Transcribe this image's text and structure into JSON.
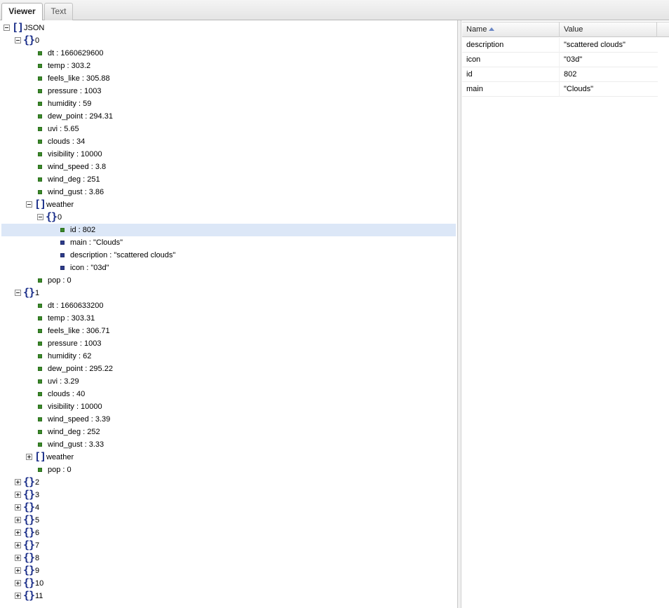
{
  "tabs": [
    {
      "label": "Viewer",
      "active": true
    },
    {
      "label": "Text",
      "active": false
    }
  ],
  "tree": [
    {
      "level": 0,
      "kind": "array",
      "label": "JSON",
      "toggle": "minus"
    },
    {
      "level": 1,
      "kind": "object",
      "label": "0",
      "toggle": "minus"
    },
    {
      "level": 2,
      "kind": "leaf",
      "label": "dt : 1660629600"
    },
    {
      "level": 2,
      "kind": "leaf",
      "label": "temp : 303.2"
    },
    {
      "level": 2,
      "kind": "leaf",
      "label": "feels_like : 305.88"
    },
    {
      "level": 2,
      "kind": "leaf",
      "label": "pressure : 1003"
    },
    {
      "level": 2,
      "kind": "leaf",
      "label": "humidity : 59"
    },
    {
      "level": 2,
      "kind": "leaf",
      "label": "dew_point : 294.31"
    },
    {
      "level": 2,
      "kind": "leaf",
      "label": "uvi : 5.65"
    },
    {
      "level": 2,
      "kind": "leaf",
      "label": "clouds : 34"
    },
    {
      "level": 2,
      "kind": "leaf",
      "label": "visibility : 10000"
    },
    {
      "level": 2,
      "kind": "leaf",
      "label": "wind_speed : 3.8"
    },
    {
      "level": 2,
      "kind": "leaf",
      "label": "wind_deg : 251"
    },
    {
      "level": 2,
      "kind": "leaf",
      "label": "wind_gust : 3.86"
    },
    {
      "level": 2,
      "kind": "array",
      "label": "weather",
      "toggle": "minus"
    },
    {
      "level": 3,
      "kind": "object",
      "label": "0",
      "toggle": "minus"
    },
    {
      "level": 4,
      "kind": "leaf",
      "label": "id : 802",
      "selected": true
    },
    {
      "level": 4,
      "kind": "leaf",
      "label": "main : \"Clouds\"",
      "blue": true
    },
    {
      "level": 4,
      "kind": "leaf",
      "label": "description : \"scattered clouds\"",
      "blue": true
    },
    {
      "level": 4,
      "kind": "leaf",
      "label": "icon : \"03d\"",
      "blue": true
    },
    {
      "level": 2,
      "kind": "leaf",
      "label": "pop : 0"
    },
    {
      "level": 1,
      "kind": "object",
      "label": "1",
      "toggle": "minus"
    },
    {
      "level": 2,
      "kind": "leaf",
      "label": "dt : 1660633200"
    },
    {
      "level": 2,
      "kind": "leaf",
      "label": "temp : 303.31"
    },
    {
      "level": 2,
      "kind": "leaf",
      "label": "feels_like : 306.71"
    },
    {
      "level": 2,
      "kind": "leaf",
      "label": "pressure : 1003"
    },
    {
      "level": 2,
      "kind": "leaf",
      "label": "humidity : 62"
    },
    {
      "level": 2,
      "kind": "leaf",
      "label": "dew_point : 295.22"
    },
    {
      "level": 2,
      "kind": "leaf",
      "label": "uvi : 3.29"
    },
    {
      "level": 2,
      "kind": "leaf",
      "label": "clouds : 40"
    },
    {
      "level": 2,
      "kind": "leaf",
      "label": "visibility : 10000"
    },
    {
      "level": 2,
      "kind": "leaf",
      "label": "wind_speed : 3.39"
    },
    {
      "level": 2,
      "kind": "leaf",
      "label": "wind_deg : 252"
    },
    {
      "level": 2,
      "kind": "leaf",
      "label": "wind_gust : 3.33"
    },
    {
      "level": 2,
      "kind": "array",
      "label": "weather",
      "toggle": "plus"
    },
    {
      "level": 2,
      "kind": "leaf",
      "label": "pop : 0"
    },
    {
      "level": 1,
      "kind": "object",
      "label": "2",
      "toggle": "plus"
    },
    {
      "level": 1,
      "kind": "object",
      "label": "3",
      "toggle": "plus"
    },
    {
      "level": 1,
      "kind": "object",
      "label": "4",
      "toggle": "plus"
    },
    {
      "level": 1,
      "kind": "object",
      "label": "5",
      "toggle": "plus"
    },
    {
      "level": 1,
      "kind": "object",
      "label": "6",
      "toggle": "plus"
    },
    {
      "level": 1,
      "kind": "object",
      "label": "7",
      "toggle": "plus"
    },
    {
      "level": 1,
      "kind": "object",
      "label": "8",
      "toggle": "plus"
    },
    {
      "level": 1,
      "kind": "object",
      "label": "9",
      "toggle": "plus"
    },
    {
      "level": 1,
      "kind": "object",
      "label": "10",
      "toggle": "plus"
    },
    {
      "level": 1,
      "kind": "object",
      "label": "11",
      "toggle": "plus"
    }
  ],
  "grid": {
    "columns": {
      "name": "Name",
      "value": "Value"
    },
    "sorted_by": "Name",
    "rows": [
      {
        "name": "description",
        "value": "\"scattered clouds\""
      },
      {
        "name": "icon",
        "value": "\"03d\""
      },
      {
        "name": "id",
        "value": "802"
      },
      {
        "name": "main",
        "value": "\"Clouds\""
      }
    ]
  },
  "colors": {
    "selection": "#dce7f7",
    "leaf_green": "#3a8a2a",
    "leaf_blue": "#2e3c8c",
    "bracket": "#1b2f8a"
  }
}
